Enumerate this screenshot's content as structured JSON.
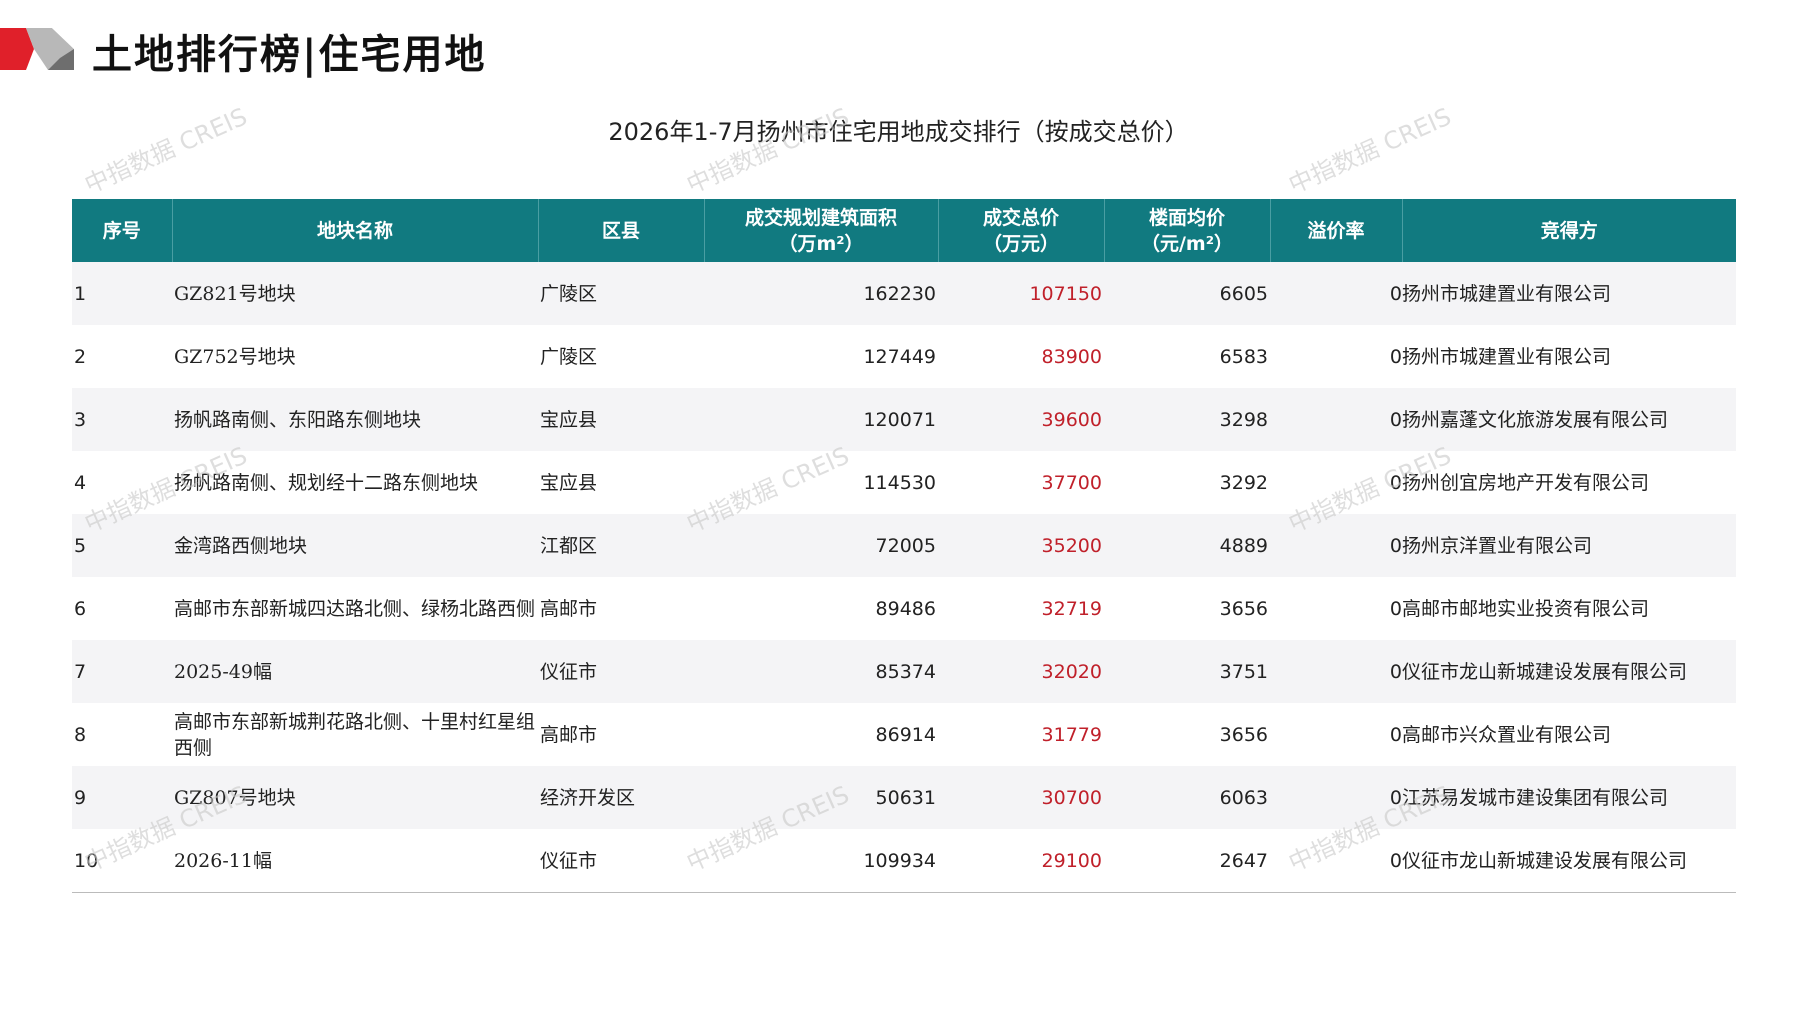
{
  "header": {
    "title": "土地排行榜|住宅用地"
  },
  "table_title": "2026年1-7月扬州市住宅用地成交排行（按成交总价）",
  "watermark_text": "中指数据 CREIS",
  "brand_colors": {
    "header_bg": "#117a80",
    "price_text": "#c0202a",
    "logo_red": "#e0202a",
    "logo_gray": "#9a9a9a"
  },
  "table": {
    "columns": [
      {
        "line1": "序号",
        "line2": ""
      },
      {
        "line1": "地块名称",
        "line2": ""
      },
      {
        "line1": "区县",
        "line2": ""
      },
      {
        "line1": "成交规划建筑面积",
        "line2": "（万m²）"
      },
      {
        "line1": "成交总价",
        "line2": "（万元）"
      },
      {
        "line1": "楼面均价",
        "line2": "（元/m²）"
      },
      {
        "line1": "溢价率",
        "line2": ""
      },
      {
        "line1": "竞得方",
        "line2": ""
      }
    ],
    "rows": [
      {
        "rank": "1",
        "name": "GZ821号地块",
        "district": "广陵区",
        "area": "162230",
        "total_price": "107150",
        "floor_price": "6605",
        "premium": "0",
        "winner": "扬州市城建置业有限公司"
      },
      {
        "rank": "2",
        "name": "GZ752号地块",
        "district": "广陵区",
        "area": "127449",
        "total_price": "83900",
        "floor_price": "6583",
        "premium": "0",
        "winner": "扬州市城建置业有限公司"
      },
      {
        "rank": "3",
        "name": "扬帆路南侧、东阳路东侧地块",
        "district": "宝应县",
        "area": "120071",
        "total_price": "39600",
        "floor_price": "3298",
        "premium": "0",
        "winner": "扬州嘉蓬文化旅游发展有限公司"
      },
      {
        "rank": "4",
        "name": "扬帆路南侧、规划经十二路东侧地块",
        "district": "宝应县",
        "area": "114530",
        "total_price": "37700",
        "floor_price": "3292",
        "premium": "0",
        "winner": "扬州创宜房地产开发有限公司"
      },
      {
        "rank": "5",
        "name": "金湾路西侧地块",
        "district": "江都区",
        "area": "72005",
        "total_price": "35200",
        "floor_price": "4889",
        "premium": "0",
        "winner": "扬州京洋置业有限公司"
      },
      {
        "rank": "6",
        "name": "高邮市东部新城四达路北侧、绿杨北路西侧",
        "district": "高邮市",
        "area": "89486",
        "total_price": "32719",
        "floor_price": "3656",
        "premium": "0",
        "winner": "高邮市邮地实业投资有限公司"
      },
      {
        "rank": "7",
        "name": "2025-49幅",
        "district": "仪征市",
        "area": "85374",
        "total_price": "32020",
        "floor_price": "3751",
        "premium": "0",
        "winner": "仪征市龙山新城建设发展有限公司"
      },
      {
        "rank": "8",
        "name": "高邮市东部新城荆花路北侧、十里村红星组西侧",
        "district": "高邮市",
        "area": "86914",
        "total_price": "31779",
        "floor_price": "3656",
        "premium": "0",
        "winner": "高邮市兴众置业有限公司"
      },
      {
        "rank": "9",
        "name": "GZ807号地块",
        "district": "经济开发区",
        "area": "50631",
        "total_price": "30700",
        "floor_price": "6063",
        "premium": "0",
        "winner": "江苏易发城市建设集团有限公司"
      },
      {
        "rank": "10",
        "name": "2026-11幅",
        "district": "仪征市",
        "area": "109934",
        "total_price": "29100",
        "floor_price": "2647",
        "premium": "0",
        "winner": "仪征市龙山新城建设发展有限公司"
      }
    ]
  }
}
